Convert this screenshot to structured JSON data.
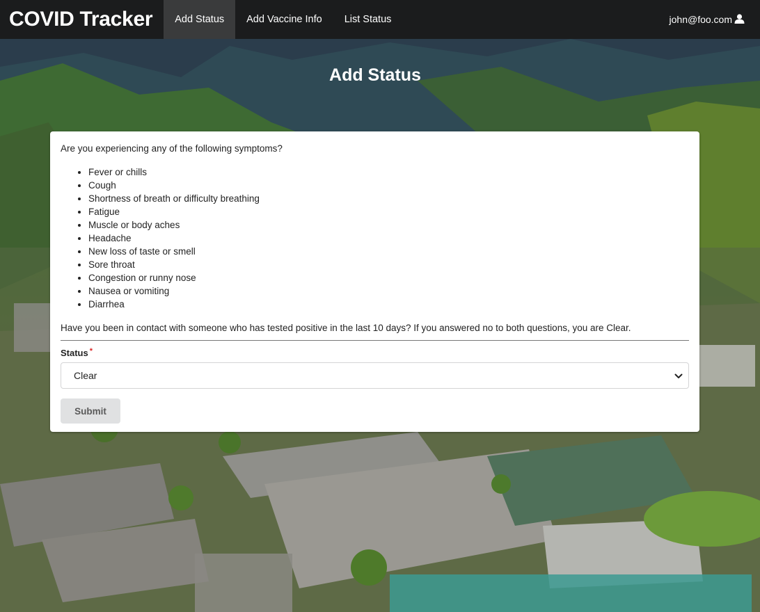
{
  "navbar": {
    "brand": "COVID Tracker",
    "items": [
      {
        "label": "Add Status",
        "active": true
      },
      {
        "label": "Add Vaccine Info",
        "active": false
      },
      {
        "label": "List Status",
        "active": false
      }
    ],
    "user_email": "john@foo.com",
    "user_icon": "user-icon"
  },
  "page": {
    "title": "Add Status"
  },
  "form": {
    "question1": "Are you experiencing any of the following symptoms?",
    "symptoms": [
      "Fever or chills",
      "Cough",
      "Shortness of breath or difficulty breathing",
      "Fatigue",
      "Muscle or body aches",
      "Headache",
      "New loss of taste or smell",
      "Sore throat",
      "Congestion or runny nose",
      "Nausea or vomiting",
      "Diarrhea"
    ],
    "question2": "Have you been in contact with someone who has tested positive in the last 10 days? If you answered no to both questions, you are Clear.",
    "status_label": "Status",
    "required_mark": "*",
    "status_value": "Clear",
    "submit_label": "Submit"
  },
  "colors": {
    "navbar_bg": "#1b1c1d",
    "active_tab_bg": "#3a3b3c",
    "required": "#db2828",
    "submit_bg": "#e0e1e2"
  }
}
